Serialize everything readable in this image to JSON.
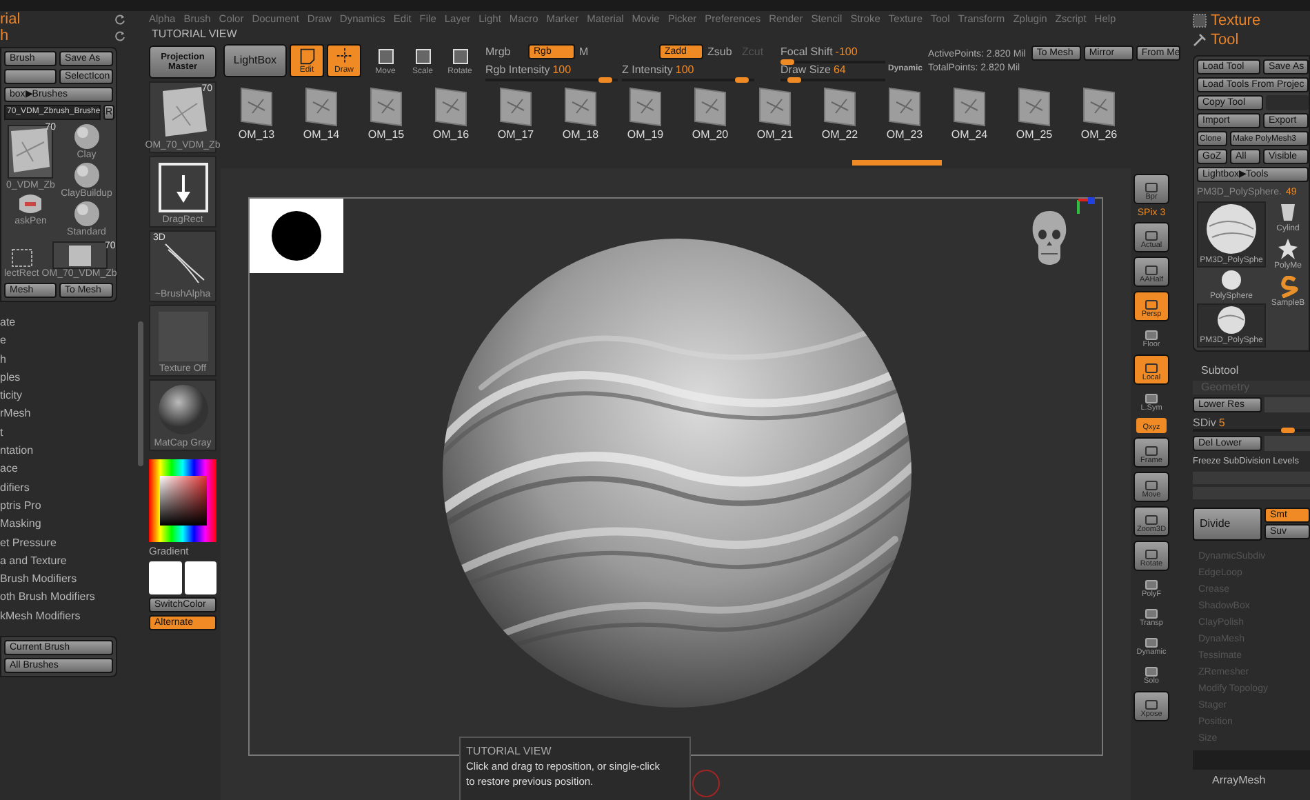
{
  "menu_bar": [
    "Alpha",
    "Brush",
    "Color",
    "Document",
    "Draw",
    "Dynamics",
    "Edit",
    "File",
    "Layer",
    "Light",
    "Macro",
    "Marker",
    "Material",
    "Movie",
    "Picker",
    "Preferences",
    "Render",
    "Stencil",
    "Stroke",
    "Texture",
    "Tool",
    "Transform",
    "Zplugin",
    "Zscript",
    "Help"
  ],
  "view_label": "TUTORIAL VIEW",
  "left_panel": {
    "palettes": [
      "rial",
      "h"
    ],
    "button_rows": [
      [
        "Brush",
        "Save As"
      ],
      [
        "SelectIcon"
      ],
      [
        "box▶Brushes"
      ]
    ],
    "current_brush": "70_VDM_Zbrush_Brushe",
    "r_button": "R",
    "brushes": [
      {
        "kind": "large",
        "label": "0_VDM_Zb",
        "badge": "70"
      },
      {
        "kind": "sphere",
        "label": "Clay"
      },
      {
        "kind": "sphere",
        "label": "ClayBuildup"
      },
      {
        "kind": "sphere",
        "label": "Standard"
      },
      {
        "kind": "mask",
        "label": "askPen"
      },
      {
        "kind": "rect",
        "label": "lectRect"
      },
      {
        "kind": "wide",
        "label": "OM_70_VDM_Zb",
        "badge": "70"
      }
    ],
    "mesh_buttons": [
      "Mesh",
      "To Mesh"
    ],
    "sections": [
      "ate",
      "e",
      "h",
      "ples",
      "ticity",
      "rMesh",
      "t",
      "ntation",
      "ace",
      "difiers",
      "ptris Pro",
      "Masking",
      "et Pressure",
      "a and Texture",
      "Brush Modifiers",
      "oth Brush Modifiers",
      "kMesh Modifiers"
    ],
    "bottom_buttons": [
      "Current Brush",
      "All Brushes"
    ]
  },
  "shelf": {
    "projection_master": "Projection Master",
    "items": [
      {
        "kind": "brush",
        "label": "OM_70_VDM_Zb",
        "badge": "70"
      },
      {
        "kind": "stroke",
        "label": "DragRect"
      },
      {
        "kind": "alpha",
        "label": "~BrushAlpha",
        "badge": "3D"
      },
      {
        "kind": "texture",
        "label": "Texture Off"
      },
      {
        "kind": "material",
        "label": "MatCap Gray"
      }
    ],
    "gradient": "Gradient",
    "switch_color": "SwitchColor",
    "alternate": {
      "label": "Alternate",
      "on": true
    }
  },
  "toolbar": {
    "lightbox": "LightBox",
    "modes": [
      {
        "label": "Edit",
        "on": true
      },
      {
        "label": "Draw",
        "on": true
      },
      {
        "label": "Move",
        "on": false
      },
      {
        "label": "Scale",
        "on": false
      },
      {
        "label": "Rotate",
        "on": false
      }
    ],
    "color_modes": [
      {
        "label": "Mrgb",
        "on": false
      },
      {
        "label": "Rgb",
        "on": true
      },
      {
        "label": "M",
        "on": false
      }
    ],
    "depth_modes": [
      {
        "label": "Zadd",
        "on": true
      },
      {
        "label": "Zsub",
        "on": false
      },
      {
        "label": "Zcut",
        "disabled": true
      }
    ],
    "sliders": [
      {
        "label": "Rgb Intensity",
        "value": "100",
        "level": 0.95
      },
      {
        "label": "Z Intensity",
        "value": "100",
        "level": 0.95
      },
      {
        "label": "Focal Shift",
        "value": "-100",
        "level": 0.0
      },
      {
        "label": "Draw Size",
        "value": "64",
        "level": 0.08
      }
    ],
    "dynamic": "Dynamic",
    "active_points": "ActivePoints: 2.820 Mil",
    "total_points": "TotalPoints: 2.820 Mil",
    "buttons": [
      "To Mesh",
      "Mirror",
      "From Me"
    ]
  },
  "brush_strip": [
    "OM_13",
    "OM_14",
    "OM_15",
    "OM_16",
    "OM_17",
    "OM_18",
    "OM_19",
    "OM_20",
    "OM_21",
    "OM_22",
    "OM_23",
    "OM_24",
    "OM_25",
    "OM_26"
  ],
  "tooltip": {
    "title": "TUTORIAL VIEW",
    "text": "Click and drag to reposition, or single-click\nto restore previous position."
  },
  "view_controls": [
    {
      "label": "Bpr",
      "on": false,
      "kind": "button"
    },
    {
      "label": "SPix 3",
      "kind": "text"
    },
    {
      "label": "Actual",
      "on": false,
      "kind": "button"
    },
    {
      "label": "AAHalf",
      "on": false,
      "kind": "button"
    },
    {
      "label": "Persp",
      "on": true,
      "kind": "button"
    },
    {
      "label": "Floor",
      "on": false,
      "kind": "flat"
    },
    {
      "label": "Local",
      "on": true,
      "kind": "button"
    },
    {
      "label": "L.Sym",
      "on": false,
      "kind": "flat"
    },
    {
      "label": "Qxyz",
      "on": true,
      "kind": "small"
    },
    {
      "label": "Frame",
      "on": false,
      "kind": "button"
    },
    {
      "label": "Move",
      "on": false,
      "kind": "button"
    },
    {
      "label": "Zoom3D",
      "on": false,
      "kind": "button"
    },
    {
      "label": "Rotate",
      "on": false,
      "kind": "button"
    },
    {
      "label": "PolyF",
      "on": false,
      "kind": "flat"
    },
    {
      "label": "Transp",
      "on": false,
      "kind": "flat"
    },
    {
      "label": "Dynamic",
      "on": false,
      "kind": "flat"
    },
    {
      "label": "Solo",
      "on": false,
      "kind": "flat"
    },
    {
      "label": "Xpose",
      "on": false,
      "kind": "button"
    }
  ],
  "right_panel": {
    "palettes": [
      "Texture",
      "Tool"
    ],
    "button_rows": [
      [
        "Load Tool",
        "Save As"
      ],
      [
        "Load Tools From Projec"
      ],
      [
        "Copy Tool"
      ],
      [
        "Import",
        "Export"
      ],
      [
        "Clone",
        "Make PolyMesh3"
      ],
      [
        "GoZ",
        "All",
        "Visible"
      ],
      [
        "Lightbox▶Tools"
      ]
    ],
    "current_tool": "PM3D_PolySphere.",
    "tool_count": "49",
    "tools": [
      {
        "kind": "large",
        "label": "PM3D_PolySphe"
      },
      {
        "kind": "ball",
        "label": "PolySphere"
      },
      {
        "kind": "large",
        "label": "PM3D_PolySphe"
      },
      {
        "kind": "cylinder",
        "label": "Cylind"
      },
      {
        "kind": "star",
        "label": "PolyMe"
      },
      {
        "kind": "simple",
        "label": "SampleB"
      }
    ],
    "subtool": "Subtool",
    "geometry": "Geometry",
    "lower_res": "Lower Res",
    "sdiv": {
      "label": "SDiv",
      "value": "5",
      "level": 0.85
    },
    "del_lower": "Del Lower",
    "freeze": "Freeze SubDivision Levels",
    "divide": "Divide",
    "divide_options": [
      {
        "label": "Smt",
        "on": true
      },
      {
        "label": "Suv",
        "on": false
      }
    ],
    "sections": [
      "DynamicSubdiv",
      "EdgeLoop",
      "Crease",
      "ShadowBox",
      "ClayPolish",
      "DynaMesh",
      "Tessimate",
      "ZRemesher",
      "Modify Topology",
      "Stager",
      "Position",
      "Size"
    ],
    "array_mesh": "ArrayMesh"
  }
}
